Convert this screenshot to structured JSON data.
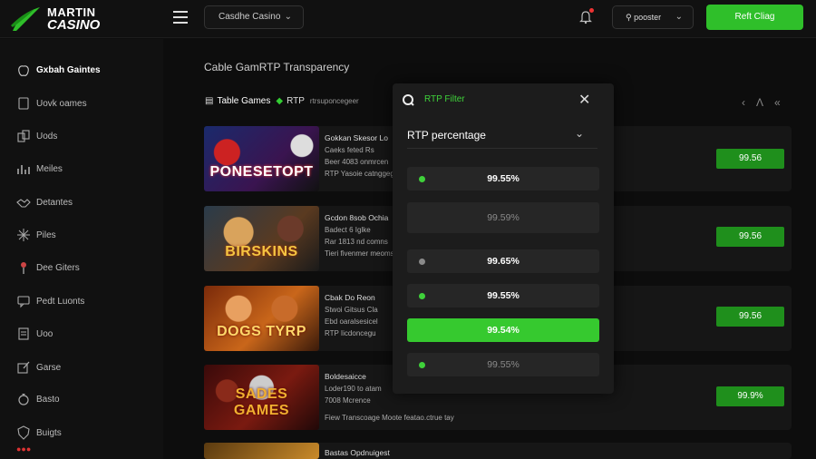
{
  "header": {
    "logo_line1": "MARTIN",
    "logo_line2": "CASINO",
    "casino_select": "Casdhe Casino",
    "user_select": "pooster",
    "cta_label": "Reft Cliag"
  },
  "sidebar": {
    "items": [
      {
        "label": "Gxbah Gaintes",
        "icon": "apple-icon"
      },
      {
        "label": "Uovk oames",
        "icon": "card-icon"
      },
      {
        "label": "Uods",
        "icon": "cards-icon"
      },
      {
        "label": "Meiles",
        "icon": "chart-icon"
      },
      {
        "label": "Detantes",
        "icon": "handshake-icon"
      },
      {
        "label": "Piles",
        "icon": "spark-icon"
      },
      {
        "label": "Dee Giters",
        "icon": "pin-icon"
      },
      {
        "label": "Pedt Luonts",
        "icon": "chat-icon"
      },
      {
        "label": "Uoo",
        "icon": "doc-icon"
      },
      {
        "label": "Garse",
        "icon": "edit-icon"
      },
      {
        "label": "Basto",
        "icon": "ring-icon"
      },
      {
        "label": "Buigts",
        "icon": "shield-icon"
      }
    ]
  },
  "main": {
    "title": "Cable GamRTP Transparency",
    "breadcrumb": {
      "part1": "Table Games",
      "part2": "RTP",
      "part3": "rtrsuponcegeer"
    }
  },
  "rows": [
    {
      "thumb_title": "PONESETOPT",
      "lines": [
        "Gokkan Skesor Lo",
        "Caeks feted Rs",
        "Beer 4083 onmrcen",
        "RTP Yasoie catnggeg"
      ],
      "rtp": "99.56"
    },
    {
      "thumb_title": "BIRSKINS",
      "lines": [
        "Gcdon 8sob Ochia",
        "Badect 6 Iglke",
        "Rar 1813 nd comns",
        "Tieri fivenmer meomsers"
      ],
      "rtp": "99.56"
    },
    {
      "thumb_title": "DOGS TYRP",
      "lines": [
        "Cbak Do Reon",
        "Stwoi Gitsus Cla",
        "Ebd oaralsesicel",
        "RTP Iicdoncegu"
      ],
      "rtp": "99.56"
    },
    {
      "thumb_title": "SADES GAMES",
      "lines": [
        "Boldesaicce",
        "Loder190 to atam",
        "7008 Mcrence",
        "Fiew Transcoage Moote featao.ctrue tay"
      ],
      "rtp": "99.9%"
    },
    {
      "thumb_title": "",
      "lines": [
        "Bastas Opdnuigest"
      ],
      "rtp": ""
    }
  ],
  "modal": {
    "title": "RTP Filter",
    "dropdown_label": "RTP percentage",
    "options": [
      {
        "value": "99.55%",
        "state": "normal",
        "dot": "#3fd13a"
      },
      {
        "value": "99.59%",
        "state": "dim",
        "dot": ""
      },
      {
        "value": "99.65%",
        "state": "normal",
        "dot": "#8a8a8a"
      },
      {
        "value": "99.55%",
        "state": "normal",
        "dot": "#3fd13a"
      },
      {
        "value": "99.54%",
        "state": "selected",
        "dot": ""
      },
      {
        "value": "99.55%",
        "state": "dim",
        "dot": "#3fd13a"
      }
    ]
  },
  "colors": {
    "accent": "#2fbf2a",
    "badge": "#1f8f1c",
    "modal_title": "#3fd13a"
  }
}
